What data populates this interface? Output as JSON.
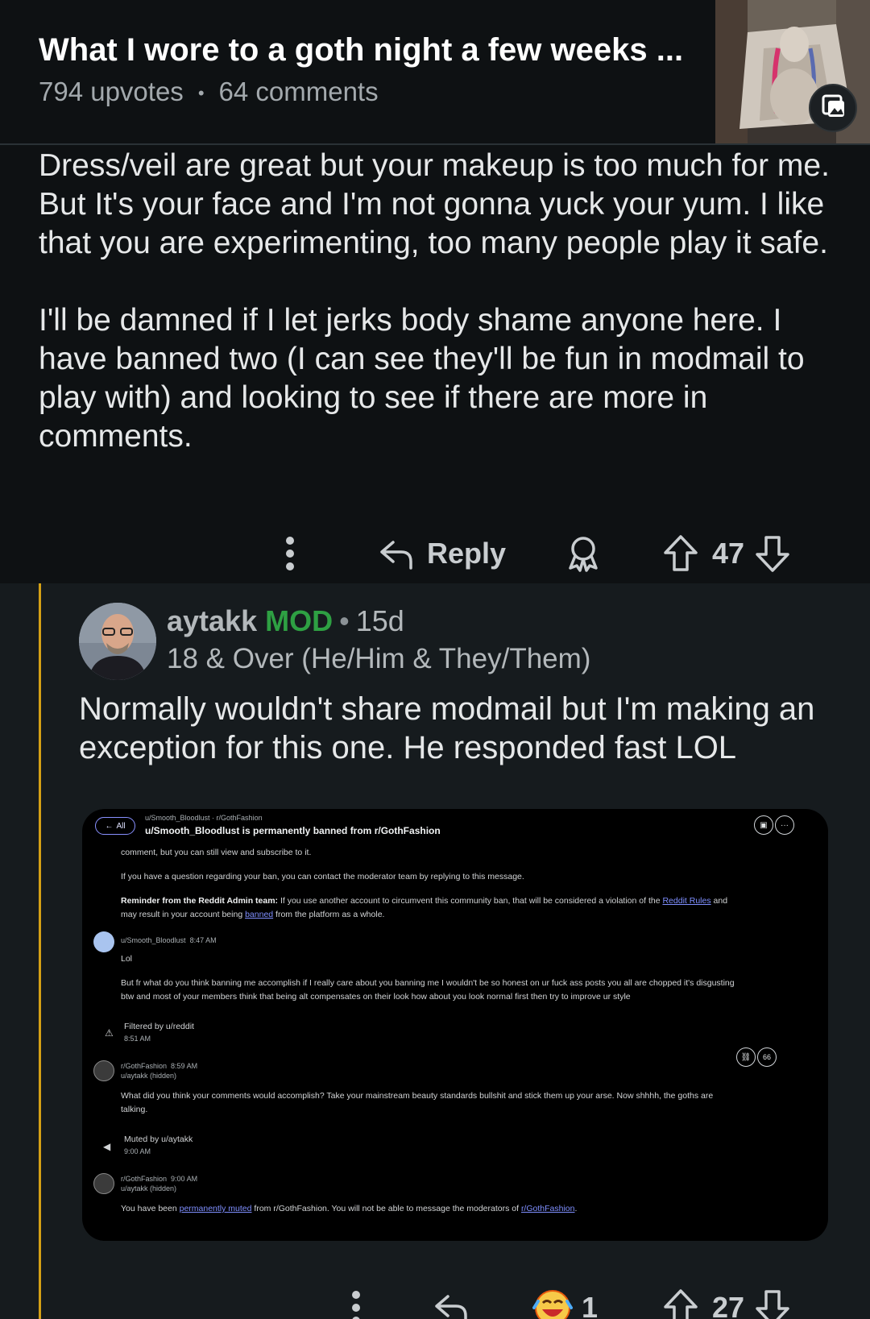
{
  "header": {
    "title": "What I wore to a goth night a few weeks ...",
    "upvotes": "794 upvotes",
    "separator": "•",
    "comments": "64 comments"
  },
  "parent_comment": {
    "paragraphs": [
      "Dress/veil are great but your makeup is too much for me. But It's your face and I'm not gonna yuck your yum. I like that you are experimenting, too many people play it safe.",
      "I'll be damned if I let jerks body shame anyone here. I have banned two (I can see they'll be fun in modmail to play with) and looking to see if there are more in comments."
    ],
    "actions": {
      "reply_label": "Reply",
      "score": "47"
    }
  },
  "reply_comment": {
    "author": "aytakk",
    "mod_badge": "MOD",
    "separator": "•",
    "age": "15d",
    "flair": "18 & Over (He/Him & They/Them)",
    "body": "Normally wouldn't share modmail but I'm making an exception for this one. He responded fast LOL",
    "award_count": "1",
    "score": "27",
    "accent_color": "#d4a015"
  },
  "modmail": {
    "back_label": "All",
    "breadcrumb": "u/Smooth_Bloodlust · r/GothFashion",
    "subject": "u/Smooth_Bloodlust is permanently banned from r/GothFashion",
    "line1": "comment, but you can still view and subscribe to it.",
    "line2": "If you have a question regarding your ban, you can contact the moderator team by replying to this message.",
    "reminder_bold": "Reminder from the Reddit Admin team:",
    "reminder_text": " If you use another account to circumvent this community ban, that will be considered a violation of the ",
    "reddit_rules": "Reddit Rules",
    "reminder_and": " and",
    "reminder_line2a": "may result in your account being ",
    "banned": "banned",
    "reminder_line2b": " from the platform as a whole.",
    "msg1_user": "u/Smooth_Bloodlust",
    "msg1_time": "8:47 AM",
    "msg1_text": "Lol",
    "msg1_long1": "But fr what do you think banning me accomplish if I really care about you banning me I wouldn't be so honest on ur fuck ass posts you all are chopped it's disgusting",
    "msg1_long2": "btw and most of your members think that being alt compensates on their look how about you look normal first then try to improve ur style",
    "filtered_label": "Filtered by u/reddit",
    "filtered_time": "8:51 AM",
    "msg2_sub": "r/GothFashion",
    "msg2_time": "8:59 AM",
    "msg2_user": "u/aytakk (hidden)",
    "msg2_text1": "What did you think your comments would accomplish? Take your mainstream beauty standards bullshit and stick them up your arse. Now shhhh, the goths are",
    "msg2_text2": "talking.",
    "quote_label": "66",
    "muted_label": "Muted by u/aytakk",
    "muted_time": "9:00 AM",
    "msg3_sub": "r/GothFashion",
    "msg3_time": "9:00 AM",
    "msg3_user": "u/aytakk (hidden)",
    "msg3_a": "You have been ",
    "msg3_link": "permanently muted",
    "msg3_b": " from r/GothFashion. You will not be able to message the moderators of ",
    "msg3_link2": "r/GothFashion",
    "msg3_c": "."
  },
  "colors": {
    "background": "#0e1113",
    "reply_background": "#161b1e",
    "mod_green": "#2ea043",
    "link_blue": "#7f8fff"
  },
  "icons": [
    "more-icon",
    "reply-icon",
    "award-icon",
    "upvote-icon",
    "downvote-icon",
    "gallery-icon",
    "laughing-award-icon"
  ]
}
